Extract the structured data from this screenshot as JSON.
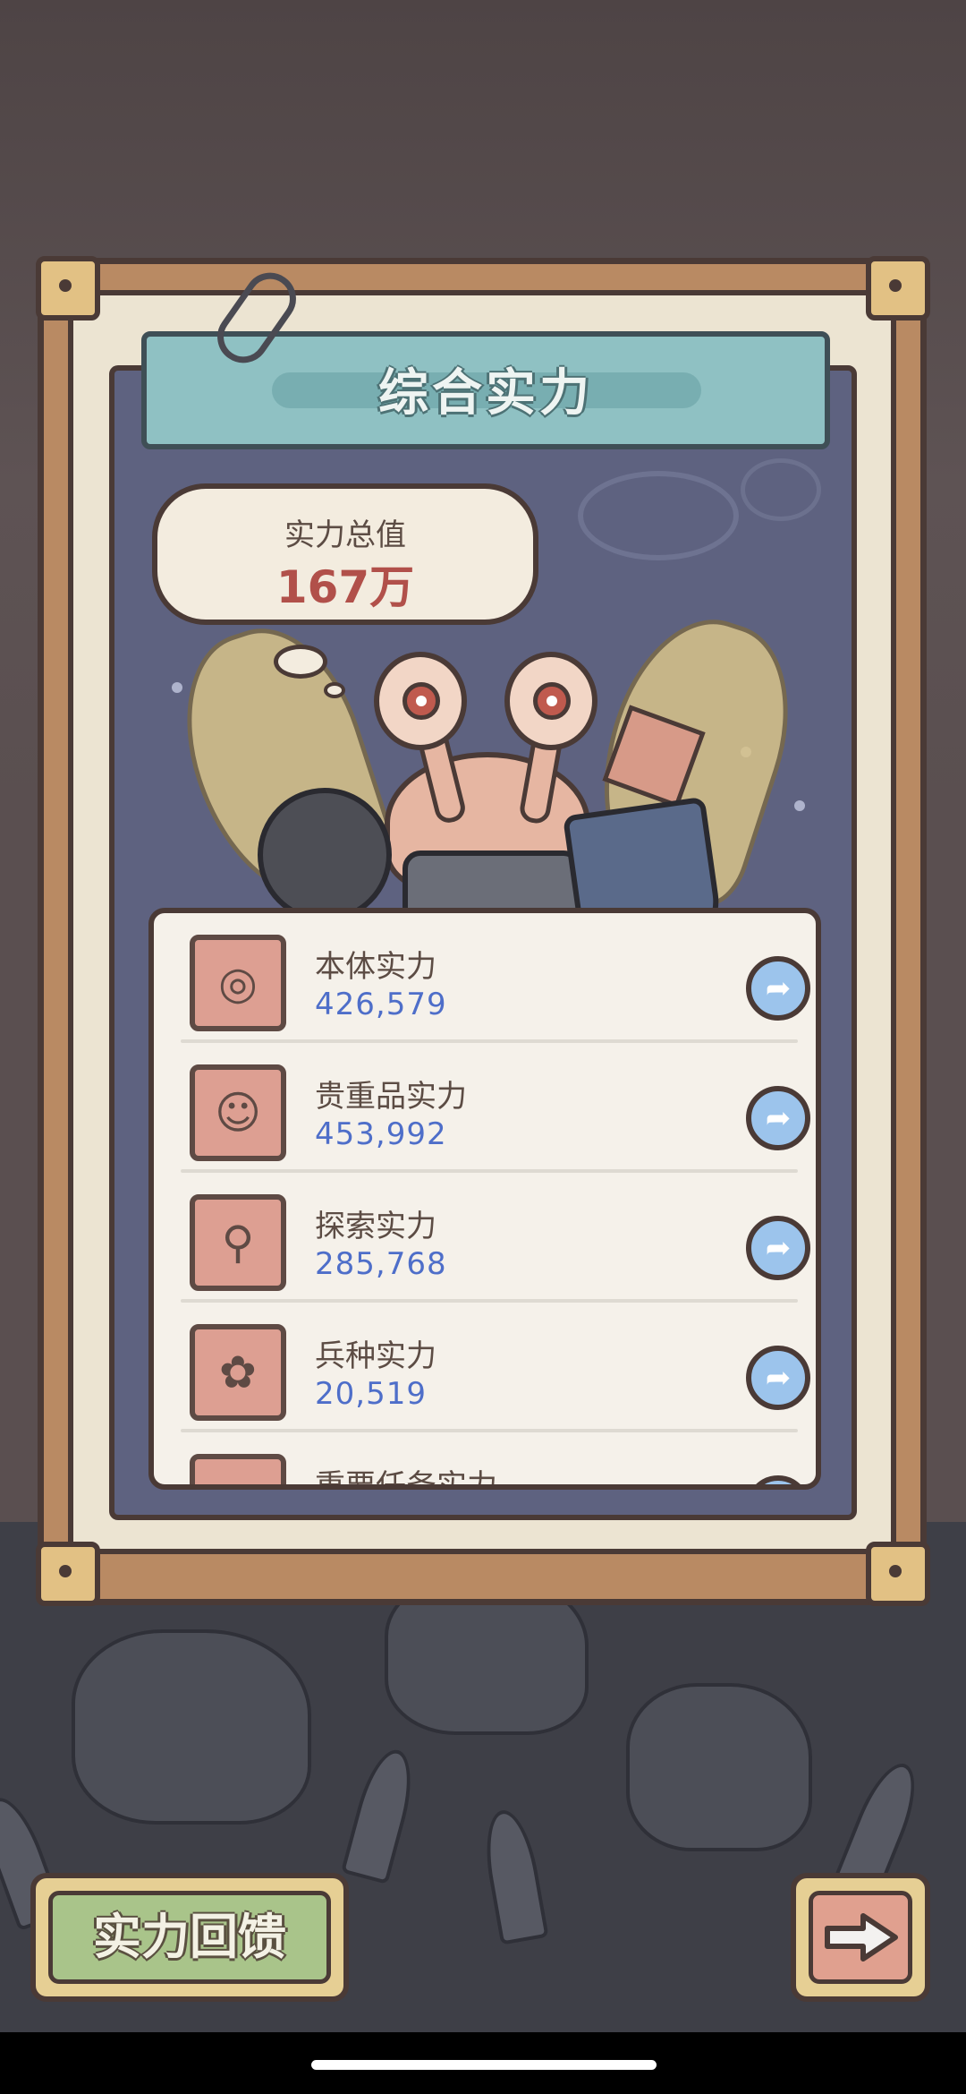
{
  "panel": {
    "title": "综合实力",
    "total_label": "实力总值",
    "total_value": "167万"
  },
  "stats": [
    {
      "name": "本体实力",
      "value": "426,579",
      "icon": "snail-icon"
    },
    {
      "name": "贵重品实力",
      "value": "453,992",
      "icon": "statue-icon"
    },
    {
      "name": "探索实力",
      "value": "285,768",
      "icon": "magnifier-icon"
    },
    {
      "name": "兵种实力",
      "value": "20,519",
      "icon": "creature-icon"
    },
    {
      "name": "重要任务实力",
      "value": "",
      "icon": "task-icon"
    }
  ],
  "buttons": {
    "feedback_label": "实力回馈",
    "next_icon": "arrow-right-icon",
    "goto_icon": "share-arrow-icon"
  },
  "colors": {
    "title_banner": "#8fc1c3",
    "total_value": "#b1504a",
    "stat_value": "#4e6ec9",
    "icon_bg": "#dd9f92",
    "goto_button": "#9cc4ec",
    "feedback_button": "#a9c48a"
  }
}
